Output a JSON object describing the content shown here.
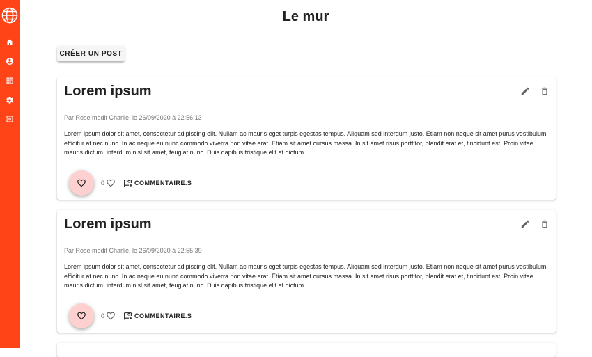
{
  "sidebar": {
    "logo_icon": "globe-icon",
    "accent_color": "#ff4518",
    "items": [
      {
        "icon": "home-icon"
      },
      {
        "icon": "account-circle-icon"
      },
      {
        "icon": "dashboard-icon"
      },
      {
        "icon": "settings-icon"
      },
      {
        "icon": "logout-icon"
      }
    ]
  },
  "page": {
    "title": "Le mur",
    "create_button": "CRÉER UN POST"
  },
  "posts": [
    {
      "title": "Lorem ipsum",
      "meta": "Par Rose modif Charlie, le 26/09/2020 à 22:56:13",
      "body": "Lorem ipsum dolor sit amet, consectetur adipiscing elit. Nullam ac mauris eget turpis egestas tempus. Aliquam sed interdum justo. Etiam non neque sit amet purus vestibulum efficitur at nec nunc. In ac neque eu nunc commodo viverra non vitae erat. Etiam sit amet cursus massa. In sit amet risus porttitor, blandit erat et, tincidunt est. Proin vitae mauris dictum, interdum nisl sit amet, feugiat nunc. Duis dapibus tristique elit at dictum.",
      "likes": "0",
      "comments_label": "COMMENTAIRE.S"
    },
    {
      "title": "Lorem ipsum",
      "meta": "Par Rose modif Charlie, le 26/09/2020 à 22:55:39",
      "body": "Lorem ipsum dolor sit amet, consectetur adipiscing elit. Nullam ac mauris eget turpis egestas tempus. Aliquam sed interdum justo. Etiam non neque sit amet purus vestibulum efficitur at nec nunc. In ac neque eu nunc commodo viverra non vitae erat. Etiam sit amet cursus massa. In sit amet risus porttitor, blandit erat et, tincidunt est. Proin vitae mauris dictum, interdum nisl sit amet, feugiat nunc. Duis dapibus tristique elit at dictum.",
      "likes": "0",
      "comments_label": "COMMENTAIRE.S"
    }
  ],
  "colors": {
    "like_fab_bg": "#ffd0d0",
    "text_primary": "#212121",
    "text_secondary": "#757575"
  }
}
